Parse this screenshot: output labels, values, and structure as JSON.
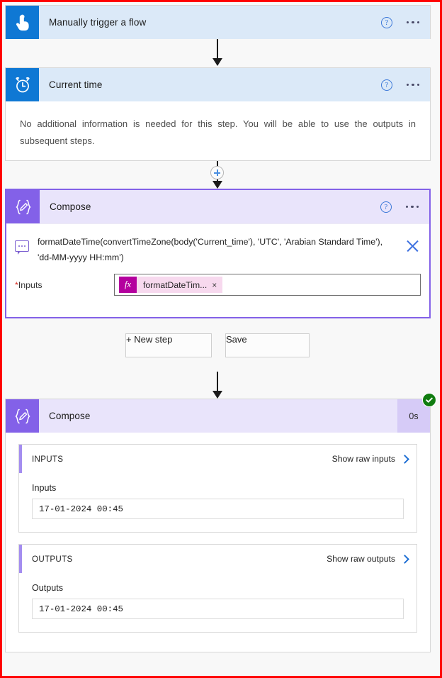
{
  "theme": {
    "frame_border": "#ff0000",
    "page_bg": "#f8f8f8",
    "trigger_header_bg": "#dbe9f8",
    "trigger_icon_bg": "#0f78d4",
    "compose_header_bg": "#e9e4fb",
    "compose_icon_bg": "#8361e8",
    "accent_blue": "#1f6fd4",
    "token_fx_bg": "#b4009e",
    "token_pill_bg": "#f7d9ee",
    "success_green": "#107c10",
    "required_star": "#d93025"
  },
  "trigger_card": {
    "title": "Manually trigger a flow",
    "icon": "tap-hand-icon",
    "help_icon": "help-icon",
    "menu_icon": "more-options-icon"
  },
  "current_time_card": {
    "title": "Current time",
    "icon": "alarm-clock-icon",
    "help_icon": "help-icon",
    "menu_icon": "more-options-icon",
    "body_text": "No additional information is needed for this step. You will be able to use the outputs in subsequent steps."
  },
  "add_step_node": {
    "icon": "plus-icon"
  },
  "compose_edit_card": {
    "title": "Compose",
    "icon": "compose-braces-pencil-icon",
    "help_icon": "help-icon",
    "menu_icon": "more-options-icon",
    "comment_icon": "comment-bubble-icon",
    "formula_text": "formatDateTime(convertTimeZone(body('Current_time'), 'UTC', 'Arabian Standard Time'), 'dd-MM-yyyy HH:mm')",
    "close_icon": "close-icon",
    "inputs_label": "Inputs",
    "required_marker": "*",
    "token": {
      "fx_label": "fx",
      "text": "formatDateTim...",
      "remove_icon": "×"
    }
  },
  "actions": {
    "new_step_label": "+ New step",
    "save_label": "Save"
  },
  "run_result_card": {
    "title": "Compose",
    "icon": "compose-braces-pencil-icon",
    "duration": "0s",
    "status_icon": "success-check-icon",
    "inputs_section": {
      "header": "INPUTS",
      "raw_link": "Show raw inputs",
      "chevron_icon": "chevron-right-icon",
      "field_label": "Inputs",
      "value": "17-01-2024 00:45"
    },
    "outputs_section": {
      "header": "OUTPUTS",
      "raw_link": "Show raw outputs",
      "chevron_icon": "chevron-right-icon",
      "field_label": "Outputs",
      "value": "17-01-2024 00:45"
    }
  }
}
